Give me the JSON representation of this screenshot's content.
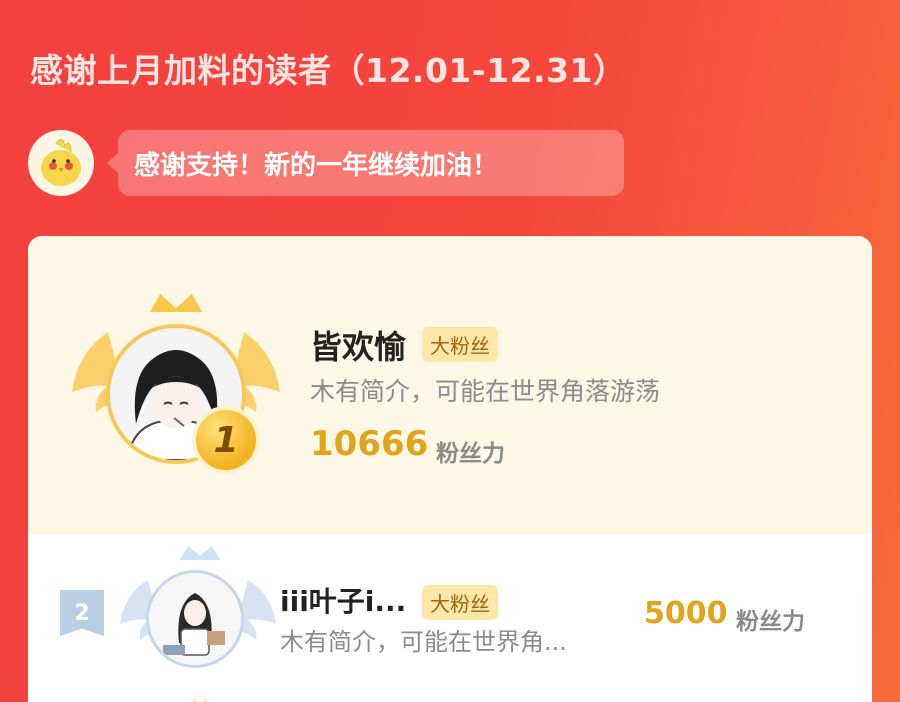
{
  "header": {
    "title": "感谢上月加料的读者（12.01-12.31）"
  },
  "greeting": {
    "message": "感谢支持！新的一年继续加油！",
    "mascot_icon": "chick-mascot-icon"
  },
  "ranking": {
    "entries": [
      {
        "rank": "1",
        "name": "皆欢愉",
        "badge": "大粉丝",
        "bio": "木有简介，可能在世界角落游荡",
        "score": "10666",
        "score_unit": "粉丝力",
        "frame_icon": "gold-crown-wings-frame-icon",
        "medal_icon": "gold-rank-medal-icon"
      },
      {
        "rank": "2",
        "name": "iii叶子i...",
        "badge": "大粉丝",
        "bio": "木有简介，可能在世界角...",
        "score": "5000",
        "score_unit": "粉丝力",
        "frame_icon": "silver-crown-wings-frame-icon",
        "medal_icon": "silver-rank-ribbon-icon"
      }
    ]
  },
  "colors": {
    "background": "#f4403f",
    "accent_gold": "#e0a51b",
    "first_place_bg": "#fdf7e6",
    "badge_bg": "#fde7a6",
    "silver": "#b9cfe6"
  }
}
